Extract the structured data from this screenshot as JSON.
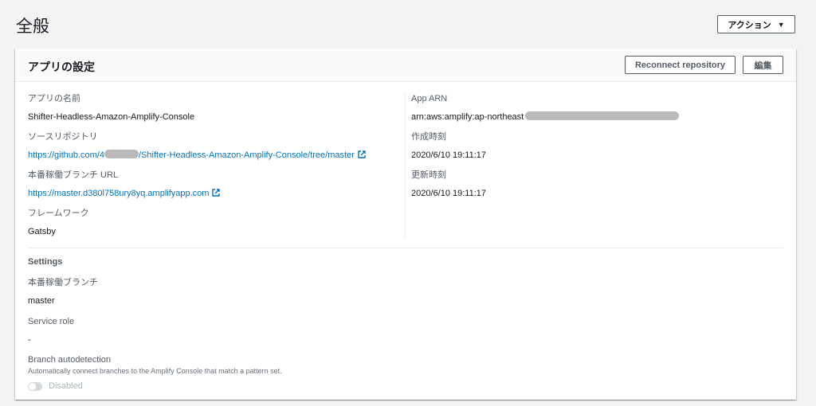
{
  "page": {
    "title": "全般",
    "action_label": "アクション"
  },
  "card": {
    "title": "アプリの設定",
    "reconnect_label": "Reconnect repository",
    "edit_label": "編集"
  },
  "details": {
    "app_name_label": "アプリの名前",
    "app_name": "Shifter-Headless-Amazon-Amplify-Console",
    "source_repo_label": "ソースリポジトリ",
    "source_repo_prefix": "https://github.com/4",
    "source_repo_suffix": "/Shifter-Headless-Amazon-Amplify-Console/tree/master",
    "prod_url_label": "本番稼働ブランチ URL",
    "prod_url": "https://master.d380l758ury8yq.amplifyapp.com",
    "framework_label": "フレームワーク",
    "framework": "Gatsby",
    "app_arn_label": "App ARN",
    "app_arn": "arn:aws:amplify:ap-northeast",
    "created_label": "作成時刻",
    "created": "2020/6/10 19:11:17",
    "updated_label": "更新時刻",
    "updated": "2020/6/10 19:11:17"
  },
  "settings": {
    "title": "Settings",
    "prod_branch_label": "本番稼働ブランチ",
    "prod_branch": "master",
    "service_role_label": "Service role",
    "service_role": "-",
    "autodetect_label": "Branch autodetection",
    "autodetect_help": "Automatically connect branches to the Amplify Console that match a pattern set.",
    "autodetect_state": "Disabled",
    "autodetect_enabled": false
  },
  "icons": {
    "external_link": "external-link-icon",
    "caret": "caret-down-icon",
    "toggle": "toggle-icon"
  },
  "colors": {
    "link": "#0073bb",
    "background": "#f2f3f3",
    "header_bg": "#fafafa"
  }
}
